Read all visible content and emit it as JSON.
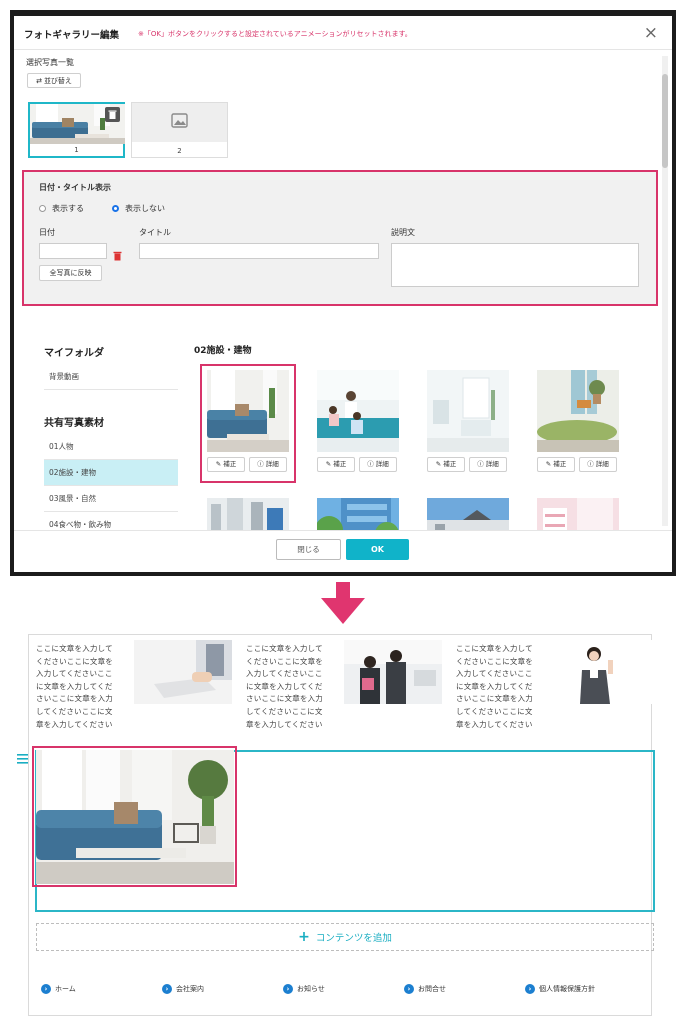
{
  "dialog": {
    "title": "フォトギャラリー編集",
    "warning": "※「OK」ボタンをクリックすると設定されているアニメーションがリセットされます。",
    "close_icon": "×",
    "selected_list_label": "選択写真一覧",
    "sort_button": "並び替え",
    "thumbnails": [
      {
        "number": "1"
      },
      {
        "number": "2"
      }
    ],
    "settings": {
      "heading": "日付・タイトル表示",
      "radio_show": "表示する",
      "radio_hide": "表示しない",
      "selected": "表示しない",
      "date_label": "日付",
      "title_label": "タイトル",
      "description_label": "説明文",
      "apply_all_button": "全写真に反映"
    },
    "left_menu": {
      "my_folder_heading": "マイフォルダ",
      "my_folder_items": [
        "背景動画"
      ],
      "shared_heading": "共有写真素材",
      "shared_items": [
        "01人物",
        "02施設・建物",
        "03風景・自然",
        "04食べ物・飲み物"
      ],
      "active_item": "02施設・建物"
    },
    "folder_title": "02施設・建物",
    "gallery_buttons": {
      "edit": "補正",
      "detail": "詳細"
    },
    "footer": {
      "close_button": "閉じる",
      "ok_button": "OK"
    }
  },
  "result": {
    "paragraph_text": "ここに文章を入力してくださいここに文章を入力してくださいここに文章を入力してくださいここに文章を入力してくださいここに文章を入力してください",
    "paragraph_lines": [
      "ここに文章を入力して",
      "くださいここに文章を",
      "入力してくださいここ",
      "に文章を入力してくだ",
      "さいここに文章を入力",
      "してくださいここに文",
      "章を入力してください"
    ],
    "add_content_label": "コンテンツを追加",
    "nav": [
      "ホーム",
      "会社案内",
      "お知らせ",
      "お問合せ",
      "個人情報保護方針"
    ]
  },
  "colors": {
    "accent": "#10b3c9",
    "highlight": "#d8346a",
    "warning_text": "#d8346a",
    "nav_icon": "#1c7fd0"
  }
}
